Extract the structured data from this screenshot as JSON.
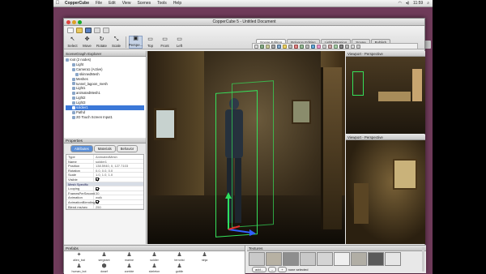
{
  "menubar": {
    "app": "CopperCube",
    "items": [
      "File",
      "Edit",
      "View",
      "Scenes",
      "Tools",
      "Help"
    ],
    "clock": "11:59"
  },
  "window": {
    "title": "CopperCube 5 - Untitled Document"
  },
  "toolbar": {
    "tools": [
      {
        "label": "Select",
        "glyph": "↖"
      },
      {
        "label": "Move",
        "glyph": "✥"
      },
      {
        "label": "Rotate",
        "glyph": "↻"
      },
      {
        "label": "Scale",
        "glyph": "⤡"
      },
      {
        "label": "Perspe...",
        "glyph": "▣"
      },
      {
        "label": "Top",
        "glyph": "▭"
      },
      {
        "label": "Front",
        "glyph": "▭"
      },
      {
        "label": "Left",
        "glyph": "▭"
      }
    ],
    "tabs": [
      "Scene Editing",
      "Polygon Editing",
      "Light Mapping",
      "Scene",
      "Publish"
    ]
  },
  "scenegraph": {
    "title": "SceneGraph Explorer",
    "nodes": [
      {
        "label": "root (2 nodes)",
        "indent": 0,
        "selected": false
      },
      {
        "label": "Light",
        "indent": 2,
        "selected": false
      },
      {
        "label": "Camera1 (Active)",
        "indent": 2,
        "selected": false
      },
      {
        "label": "skinnedMesh",
        "indent": 3,
        "selected": false
      },
      {
        "label": "Meshes",
        "indent": 2,
        "selected": false
      },
      {
        "label": "tunnel_lagoon_mesh",
        "indent": 2,
        "selected": false
      },
      {
        "label": "Light1",
        "indent": 2,
        "selected": false
      },
      {
        "label": "animatedMesh1",
        "indent": 2,
        "selected": false
      },
      {
        "label": "Light2",
        "indent": 2,
        "selected": false
      },
      {
        "label": "Light3",
        "indent": 2,
        "selected": false
      },
      {
        "label": "soldier1",
        "indent": 2,
        "selected": true
      },
      {
        "label": "Pathd",
        "indent": 2,
        "selected": false
      },
      {
        "label": "2D Touch Screen Input1",
        "indent": 2,
        "selected": false
      }
    ]
  },
  "properties": {
    "title": "Properties",
    "tabs": [
      "Attributes",
      "Materials",
      "Behavior"
    ],
    "rows": [
      {
        "k": "Type",
        "v": "AnimatedMesh",
        "kind": "text"
      },
      {
        "k": "Name",
        "v": "soldier1",
        "kind": "text"
      },
      {
        "k": "Position",
        "v": "138.5940, 0, 127.7103",
        "kind": "text"
      },
      {
        "k": "Rotation",
        "v": "0.0, 0.0, 0.0",
        "kind": "text"
      },
      {
        "k": "Scale",
        "v": "1.0, 1.0, 1.0",
        "kind": "text"
      },
      {
        "k": "Visible",
        "v": "",
        "kind": "check"
      },
      {
        "k": "Mesh Specific",
        "v": "",
        "kind": "group"
      },
      {
        "k": "Looping",
        "v": "",
        "kind": "check"
      },
      {
        "k": "FramesPerSecond",
        "v": "30",
        "kind": "text"
      },
      {
        "k": "Animation",
        "v": "walk",
        "kind": "text"
      },
      {
        "k": "AnimationBlending",
        "v": "",
        "kind": "check"
      },
      {
        "k": "Blend ms/sec",
        "v": "250",
        "kind": "text"
      }
    ]
  },
  "viewports": {
    "top_right": "Viewport - Perspective",
    "bottom_right": "Viewport - Perspective"
  },
  "prefabs": {
    "title": "Prefabs",
    "items": [
      {
        "label": "alien_bat",
        "glyph": "✦"
      },
      {
        "label": "sergeant",
        "glyph": "♟"
      },
      {
        "label": "marine",
        "glyph": "♟"
      },
      {
        "label": "soldier",
        "glyph": "♟"
      },
      {
        "label": "terrorist",
        "glyph": "♟"
      },
      {
        "label": "ninja",
        "glyph": "♟"
      },
      {
        "label": "",
        "glyph": ""
      },
      {
        "label": "human_bot",
        "glyph": "♟"
      },
      {
        "label": "dwarf",
        "glyph": "⬢"
      },
      {
        "label": "zombie",
        "glyph": "♟"
      },
      {
        "label": "skeleton",
        "glyph": "♟"
      },
      {
        "label": "goblin",
        "glyph": "♟"
      },
      {
        "label": "",
        "glyph": ""
      },
      {
        "label": "",
        "glyph": ""
      }
    ]
  },
  "textures": {
    "title": "Textures",
    "swatches": [
      "#c9c9c9",
      "#b7b1a3",
      "#8e8e8e",
      "#c8c8c8",
      "#d4d4d4",
      "#efefef",
      "#b1aea5",
      "#5a5a5a",
      "#e6e6e6"
    ],
    "add_label": "add...",
    "status": "none selected"
  },
  "colors": {
    "desktop": "#6f3b5a",
    "selection": "#3b78d8",
    "gizmo_bbox": "#35e05a",
    "gizmo_y": "#2ee05c",
    "gizmo_x": "#e03030",
    "gizmo_z": "#3060ff"
  }
}
